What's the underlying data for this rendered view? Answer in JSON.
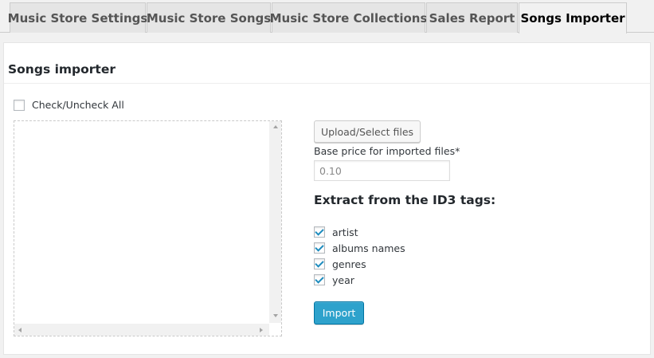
{
  "tabs": [
    {
      "label": "Music Store Settings",
      "active": false
    },
    {
      "label": "Music Store Songs",
      "active": false
    },
    {
      "label": "Music Store Collections",
      "active": false
    },
    {
      "label": "Sales Report",
      "active": false
    },
    {
      "label": "Songs Importer",
      "active": true
    }
  ],
  "panel": {
    "title": "Songs importer",
    "check_all_label": "Check/Uncheck All",
    "check_all_checked": false
  },
  "upload": {
    "label": "Upload/Select files"
  },
  "price": {
    "label": "Base price for imported files*",
    "value": "0.10"
  },
  "id3": {
    "title": "Extract from the ID3 tags:",
    "options": [
      {
        "label": "artist",
        "checked": true
      },
      {
        "label": "albums names",
        "checked": true
      },
      {
        "label": "genres",
        "checked": true
      },
      {
        "label": "year",
        "checked": true
      }
    ]
  },
  "import_button": {
    "label": "Import"
  },
  "colors": {
    "accent": "#2ea2cc",
    "checkmark": "#1e8cbe",
    "tab_bg": "#e5e5e5",
    "page_bg": "#f1f1f1"
  }
}
